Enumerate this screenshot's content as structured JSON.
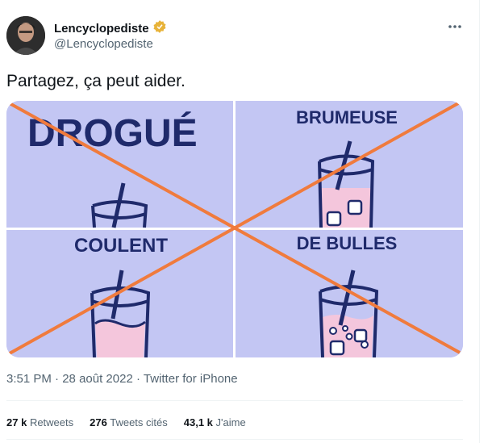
{
  "author": {
    "name": "Lencyclopediste",
    "handle": "@Lencyclopediste",
    "badge_icon": "gold-verified-icon"
  },
  "tweet": {
    "text": "Partagez, ça peut aider."
  },
  "media": {
    "panels": [
      "DROGUÉ",
      "BRUMEUSE",
      "COULENT",
      "DE BULLES"
    ],
    "colors": {
      "background": "#c3c6f3",
      "text": "#1f2a6b",
      "cross": "#f07b3d",
      "drink": "#f4c6dc"
    }
  },
  "meta": {
    "time": "3:51 PM",
    "date": "28 août 2022",
    "source": "Twitter for iPhone",
    "separator": "·"
  },
  "stats": {
    "retweets_count": "27 k",
    "retweets_label": "Retweets",
    "quotes_count": "276",
    "quotes_label": "Tweets cités",
    "likes_count": "43,1 k",
    "likes_label": "J'aime"
  }
}
